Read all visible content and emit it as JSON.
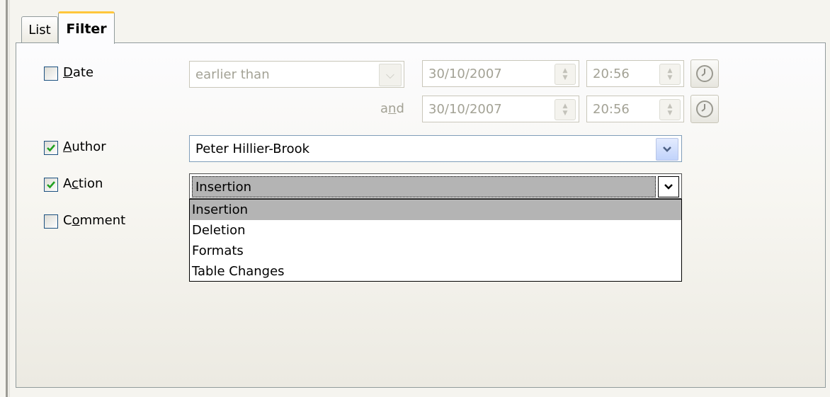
{
  "tabs": [
    {
      "label": "List"
    },
    {
      "label": "Filter"
    }
  ],
  "filters": {
    "date": {
      "label_pre": "",
      "label_mn": "D",
      "label_post": "ate",
      "checked": false,
      "condition": "earlier than",
      "start_date": "30/10/2007",
      "start_time": "20:56",
      "and_pre": "a",
      "and_mn": "n",
      "and_post": "d",
      "end_date": "30/10/2007",
      "end_time": "20:56"
    },
    "author": {
      "label_pre": "",
      "label_mn": "A",
      "label_post": "uthor",
      "checked": true,
      "value": "Peter Hillier-Brook"
    },
    "action": {
      "label_pre": "A",
      "label_mn": "c",
      "label_post": "tion",
      "checked": true,
      "value": "Insertion",
      "options": [
        "Insertion",
        "Deletion",
        "Formats",
        "Table Changes"
      ],
      "selected_index": 0
    },
    "comment": {
      "label_pre": "C",
      "label_mn": "o",
      "label_post": "mment",
      "checked": false
    }
  },
  "icons": {
    "check": "check-icon",
    "dropdown": "chevron-down-icon",
    "spin": "spin-arrows-icon",
    "clock": "clock-icon"
  },
  "colors": {
    "tab_highlight": "#ffc73c",
    "checkmark": "#21a121",
    "selection": "#b4b4b4"
  }
}
